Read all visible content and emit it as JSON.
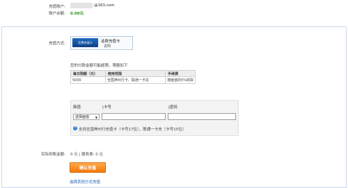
{
  "account": {
    "recharge_account_label": "充值账户:",
    "email_domain": "@163.com",
    "balance_label": "账户余额:",
    "balance_value": "0.00元"
  },
  "method": {
    "label": "充值方式:",
    "card_image_text": "话费充值卡",
    "card_name": "话费充值卡",
    "card_sub": "说明"
  },
  "limits": {
    "intro": "您的付款金额可能超限，限额如下",
    "headers": [
      "每日限额（元）",
      "使用范围",
      "手续费"
    ],
    "rows": [
      [
        "5000",
        "全国神州行卡、联通一卡充",
        "按面值的5%收取"
      ]
    ]
  },
  "form": {
    "denomination_label": "面值",
    "card_number_label": "|卡号",
    "password_label": "|密码",
    "select_value": "选择面值",
    "info_text": "支持全国神州行充值卡（卡号17位），联通一卡充（卡号15位）"
  },
  "summary": {
    "actual_label": "实际到账金额:",
    "amount_text": "0 元 | 服务费: 0 元"
  },
  "actions": {
    "confirm_label": "确认充值",
    "other_method_link": "选择其他方式充值"
  }
}
